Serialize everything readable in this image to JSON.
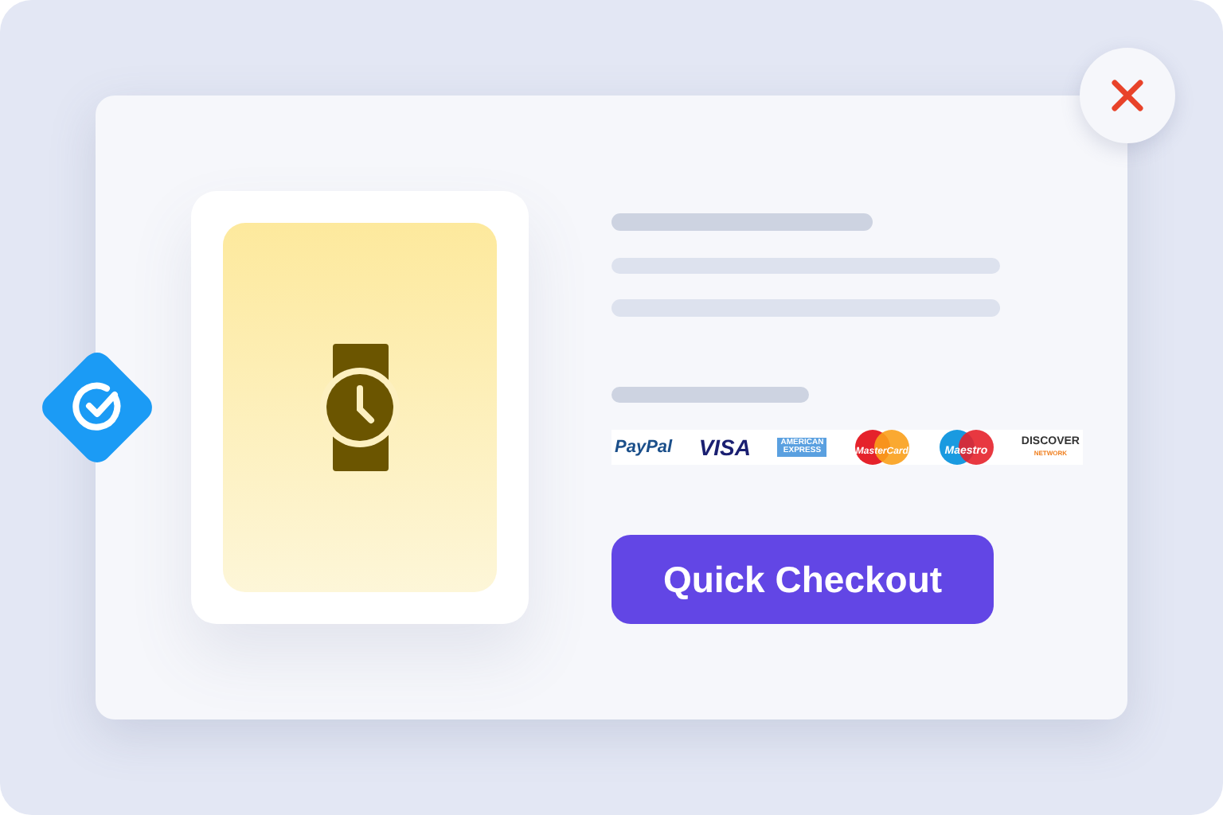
{
  "placeholder_lines": [
    {
      "kind": "title"
    },
    {
      "kind": "text"
    },
    {
      "kind": "text"
    },
    {
      "kind": "label"
    }
  ],
  "payment_logos": [
    {
      "kind": "paypal",
      "text": "PayPal"
    },
    {
      "kind": "visa",
      "text": "VISA"
    },
    {
      "kind": "amex",
      "text": "AMERICAN EXPRESS"
    },
    {
      "kind": "mastercard",
      "text": "MasterCard"
    },
    {
      "kind": "maestro",
      "text": "Maestro"
    },
    {
      "kind": "discover",
      "text": "DISCOVER",
      "subtext": "NETWORK"
    }
  ],
  "checkout_button": {
    "label": "Quick Checkout"
  }
}
